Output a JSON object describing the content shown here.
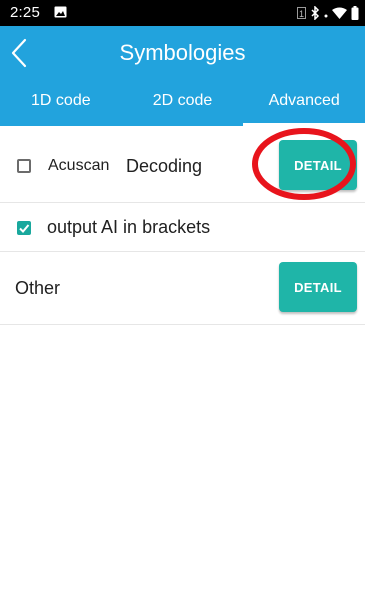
{
  "status_bar": {
    "time": "2:25",
    "sim_label": "1",
    "icons": [
      "image-notification-icon",
      "sim-icon",
      "bluetooth-icon",
      "wifi-icon",
      "battery-icon"
    ]
  },
  "app_bar": {
    "title": "Symbologies",
    "back_icon": "chevron-left-icon"
  },
  "tabs": [
    {
      "label": "1D code",
      "active": false
    },
    {
      "label": "2D code",
      "active": false
    },
    {
      "label": "Advanced",
      "active": true
    }
  ],
  "settings": {
    "acuscan": {
      "label_prefix": "Acuscan",
      "label_suffix": "Decoding",
      "checked": false,
      "detail_label": "DETAIL"
    },
    "output_ai": {
      "label": "output AI in brackets",
      "checked": true
    },
    "other": {
      "label": "Other",
      "detail_label": "DETAIL"
    }
  },
  "colors": {
    "primary": "#22a3dd",
    "button": "#1fb5a8",
    "checkbox_checked": "#19a89d",
    "annotation": "#e8141c"
  }
}
